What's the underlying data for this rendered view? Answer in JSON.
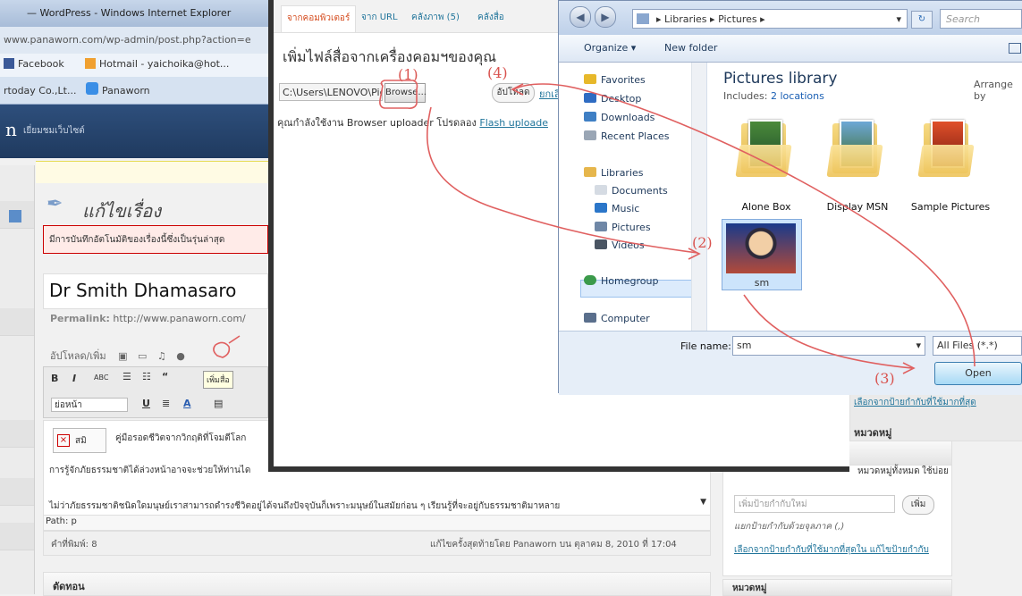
{
  "ie": {
    "title": "— WordPress - Windows Internet Explorer",
    "address": "www.panaworn.com/wp-admin/post.php?action=e",
    "favorites": [
      "Facebook",
      "Hotmail - yaichoika@hot..."
    ],
    "tabs": [
      "rtoday Co.,Lt...",
      "Panaworn"
    ]
  },
  "wp": {
    "brand": "n",
    "visit_site": "เยี่ยมชมเว็บไซต์",
    "page_title": "แก้ไขเรื่อง",
    "autosave_notice": "มีการบันทึกอัตโนมัติของเรื่องนี้ซึ่งเป็นรุ่นล่าสุด",
    "post_title": "Dr Smith Dhamasaro",
    "permalink_label": "Permalink:",
    "permalink_url": "http://www.panaworn.com/",
    "upload_label": "อัปโหลด/เพิ่ม",
    "tooltip": "เพิ่มสื่อ",
    "paragraph_select": "ย่อหน้า",
    "broken_img_label": "สมิ",
    "body_line1": "คู่มือรอดชีวิตจากวิกฤติที่โจมตีโลก",
    "body_line2": "การรู้จักภัยธรรมชาติได้ล่วงหน้าอาจจะช่วยให้ท่านได",
    "body_line3": "ไม่ว่าภัยธรรมชาติชนิดใดมนุษย์เราสามารถดำรงชีวิตอยู่ได้จนถึงปัจจุบันก็เพราะมนุษย์ในสมัยก่อน ๆ เรียนรู้ที่จะอยู่กับธรรมชาติมาหลาย",
    "path": "Path: p",
    "word_count": "คำที่พิมพ์: 8",
    "last_edited": "แก้ไขครั้งสุดท้ายโดย Panaworn บน ตุลาคม 8, 2010 ที่ 17:04",
    "excerpt_title": "ตัดทอน",
    "categories_title": "หมวดหมู่",
    "categories_all_tab": "หมวดหมู่ทั้งหมด",
    "categories_used_tab": "ใช้บ่อย",
    "tags_input_placeholder": "เพิ่มป้ายกำกับใหม่",
    "tags_add": "เพิ่ม",
    "tags_hint": "แยกป้ายกำกับด้วยจุลภาค (,)",
    "tags_link": "เลือกจากป้ายกำกับที่ใช้มากที่สุดใน แก้ไขป้ายกำกับ",
    "categories_title2": "หมวดหมู่"
  },
  "media": {
    "tabs": [
      "จากคอมพิวเตอร์",
      "จาก URL",
      "คลังภาพ (5)",
      "คลังสื่อ"
    ],
    "heading": "เพิ่มไฟล์สื่อจากเครื่องคอมฯของคุณ",
    "file_path": "C:\\Users\\LENOVO\\Pictu",
    "browse": "Browse...",
    "upload": "อัปโหลด",
    "cancel": "ยกเลิก",
    "note": "คุณกำลังใช้งาน Browser uploader โปรดลอง",
    "note_link": "Flash uploade"
  },
  "win": {
    "breadcrumb": [
      "Libraries",
      "Pictures"
    ],
    "search_placeholder": "Search Pictures",
    "organize": "Organize ▾",
    "new_folder": "New folder",
    "nav": {
      "favorites": "Favorites",
      "desktop": "Desktop",
      "downloads": "Downloads",
      "recent": "Recent Places",
      "libraries": "Libraries",
      "documents": "Documents",
      "music": "Music",
      "pictures": "Pictures",
      "videos": "Videos",
      "homegroup": "Homegroup",
      "computer": "Computer"
    },
    "library_title": "Pictures library",
    "library_includes": "Includes:",
    "library_locations": "2 locations",
    "arrange_by": "Arrange by",
    "folders": [
      "Alone Box",
      "Display MSN",
      "Sample Pictures"
    ],
    "selected_file": "sm",
    "file_name_label": "File name:",
    "file_name_value": "sm",
    "filter": "All Files (*.*)",
    "open": "Open"
  },
  "annotations": [
    "(1)",
    "(2)",
    "(3)",
    "(4)"
  ],
  "colors": {
    "annotation": "#d9534f",
    "wp_link": "#21759b",
    "win_chrome": "#c6d5ea"
  }
}
